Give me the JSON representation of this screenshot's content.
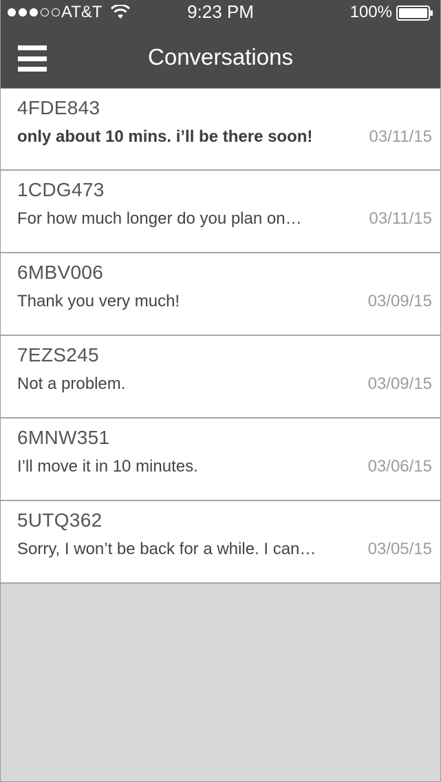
{
  "status_bar": {
    "carrier": "AT&T",
    "signal_bars": 3,
    "signal_max": 5,
    "time": "9:23 PM",
    "battery": "100%"
  },
  "nav": {
    "title": "Conversations",
    "menu_icon": "hamburger-menu-icon"
  },
  "conversations": [
    {
      "plate": "4FDE843",
      "preview": "only about 10 mins. i’ll be there soon!",
      "date": "03/11/15",
      "unread": true
    },
    {
      "plate": "1CDG473",
      "preview": "For how much longer do you plan on…",
      "date": "03/11/15",
      "unread": false
    },
    {
      "plate": "6MBV006",
      "preview": "Thank you very much!",
      "date": "03/09/15",
      "unread": false
    },
    {
      "plate": "7EZS245",
      "preview": "Not a problem.",
      "date": "03/09/15",
      "unread": false
    },
    {
      "plate": "6MNW351",
      "preview": "I’ll move it in 10 minutes.",
      "date": "03/06/15",
      "unread": false
    },
    {
      "plate": "5UTQ362",
      "preview": "Sorry, I won’t be back for a while. I can…",
      "date": "03/05/15",
      "unread": false
    }
  ],
  "colors": {
    "nav_bg": "#4a4a4a",
    "list_bg": "#ffffff",
    "empty_bg": "#d8d8d8",
    "date_text": "#9c9c9c"
  }
}
